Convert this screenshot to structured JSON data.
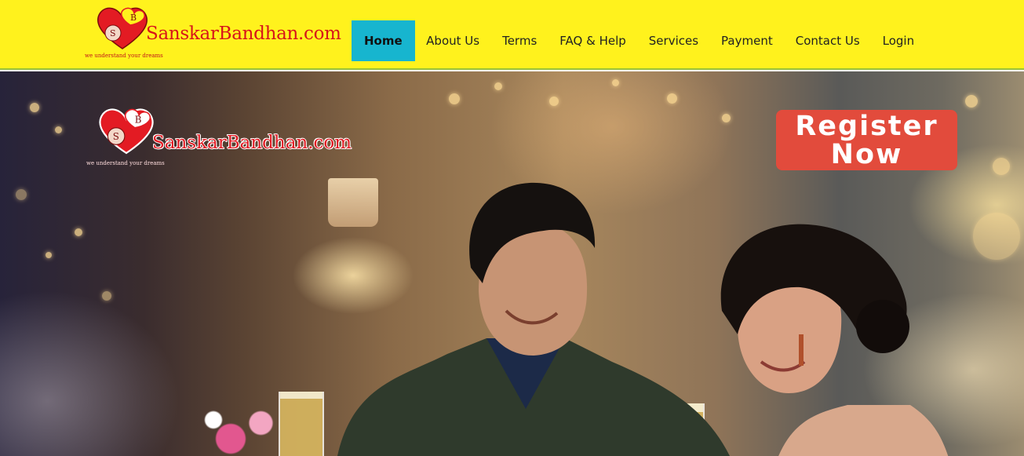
{
  "brand": {
    "name": "SanskarBandhan.com",
    "tagline": "we understand your dreams",
    "logo_initials": "SB",
    "colors": {
      "header_bg": "#fff21d",
      "active_nav": "#17b5cf",
      "logo_red": "#d7141a",
      "cta": "#e24b3c"
    }
  },
  "nav": {
    "items": [
      {
        "label": "Home",
        "active": true
      },
      {
        "label": "About Us"
      },
      {
        "label": "Terms"
      },
      {
        "label": "FAQ & Help"
      },
      {
        "label": "Services"
      },
      {
        "label": "Payment"
      },
      {
        "label": "Contact Us"
      },
      {
        "label": "Login"
      }
    ]
  },
  "hero": {
    "logo_name": "SanskarBandhan.com",
    "logo_tagline": "we understand your dreams",
    "cta_line1": "Register",
    "cta_line2": "Now"
  }
}
